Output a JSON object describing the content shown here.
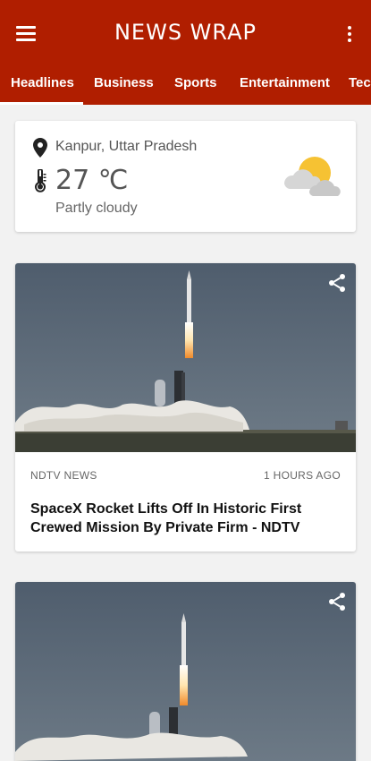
{
  "app": {
    "title": "NEWS WRAP",
    "brand_color": "#b01e00"
  },
  "tabs": [
    {
      "label": "Headlines",
      "selected": true
    },
    {
      "label": "Business",
      "selected": false
    },
    {
      "label": "Sports",
      "selected": false
    },
    {
      "label": "Entertainment",
      "selected": false
    },
    {
      "label": "Tech",
      "selected": false
    }
  ],
  "weather": {
    "location": "Kanpur, Uttar Pradesh",
    "temperature": "27 ℃",
    "condition": "Partly cloudy",
    "icon": "partly-cloudy-icon"
  },
  "articles": [
    {
      "source": "NDTV NEWS",
      "time": "1 HOURS AGO",
      "headline": "SpaceX Rocket Lifts Off In Historic First Crewed Mission By Private Firm - NDTV",
      "image": "rocket-launch-image"
    },
    {
      "source": "",
      "time": "",
      "headline": "",
      "image": "rocket-launch-image"
    }
  ]
}
